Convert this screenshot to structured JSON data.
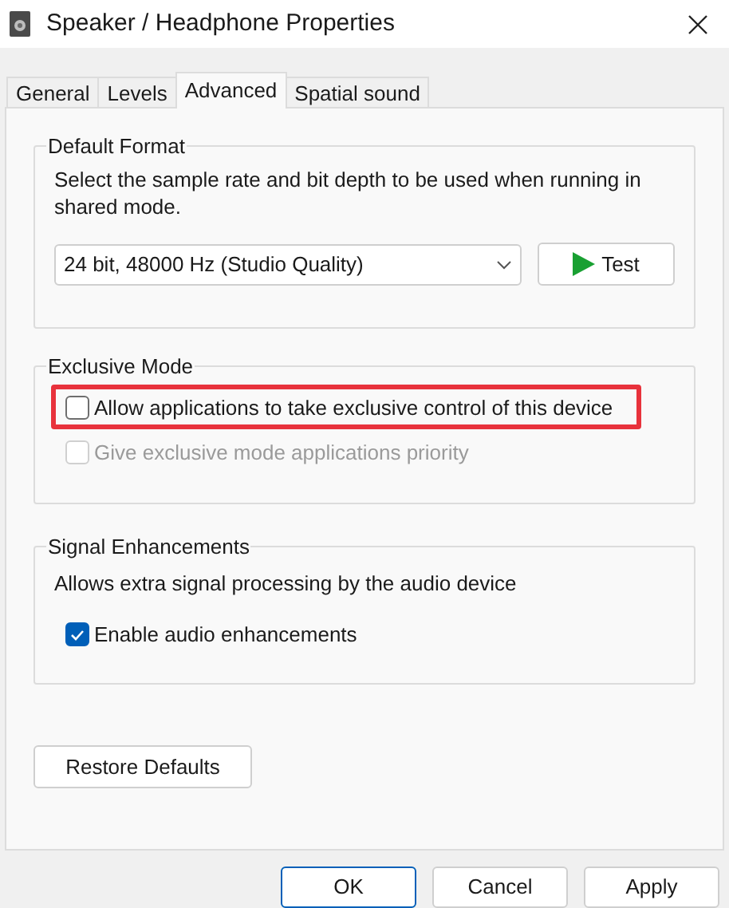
{
  "window": {
    "title": "Speaker / Headphone Properties"
  },
  "tabs": [
    {
      "label": "General",
      "selected": false
    },
    {
      "label": "Levels",
      "selected": false
    },
    {
      "label": "Advanced",
      "selected": true
    },
    {
      "label": "Spatial sound",
      "selected": false
    }
  ],
  "groups": [
    {
      "title": "Default Format",
      "description": "Select the sample rate and bit depth to be used when running in shared mode.",
      "format_select": {
        "value": "24 bit, 48000 Hz (Studio Quality)"
      },
      "test_button": {
        "label": "Test"
      }
    },
    {
      "title": "Exclusive Mode",
      "options": [
        {
          "label": "Allow applications to take exclusive control of this device",
          "checked": false,
          "disabled": false,
          "highlighted": true
        },
        {
          "label": "Give exclusive mode applications priority",
          "checked": false,
          "disabled": true,
          "highlighted": false
        }
      ]
    },
    {
      "title": "Signal Enhancements",
      "description": "Allows extra signal processing by the audio device",
      "options": [
        {
          "label": "Enable audio enhancements",
          "checked": true,
          "disabled": false,
          "highlighted": false
        }
      ]
    }
  ],
  "restore_button": {
    "label": "Restore Defaults"
  },
  "buttons": [
    {
      "label": "OK",
      "selected": true
    },
    {
      "label": "Cancel",
      "selected": false
    },
    {
      "label": "Apply",
      "selected": false
    }
  ]
}
